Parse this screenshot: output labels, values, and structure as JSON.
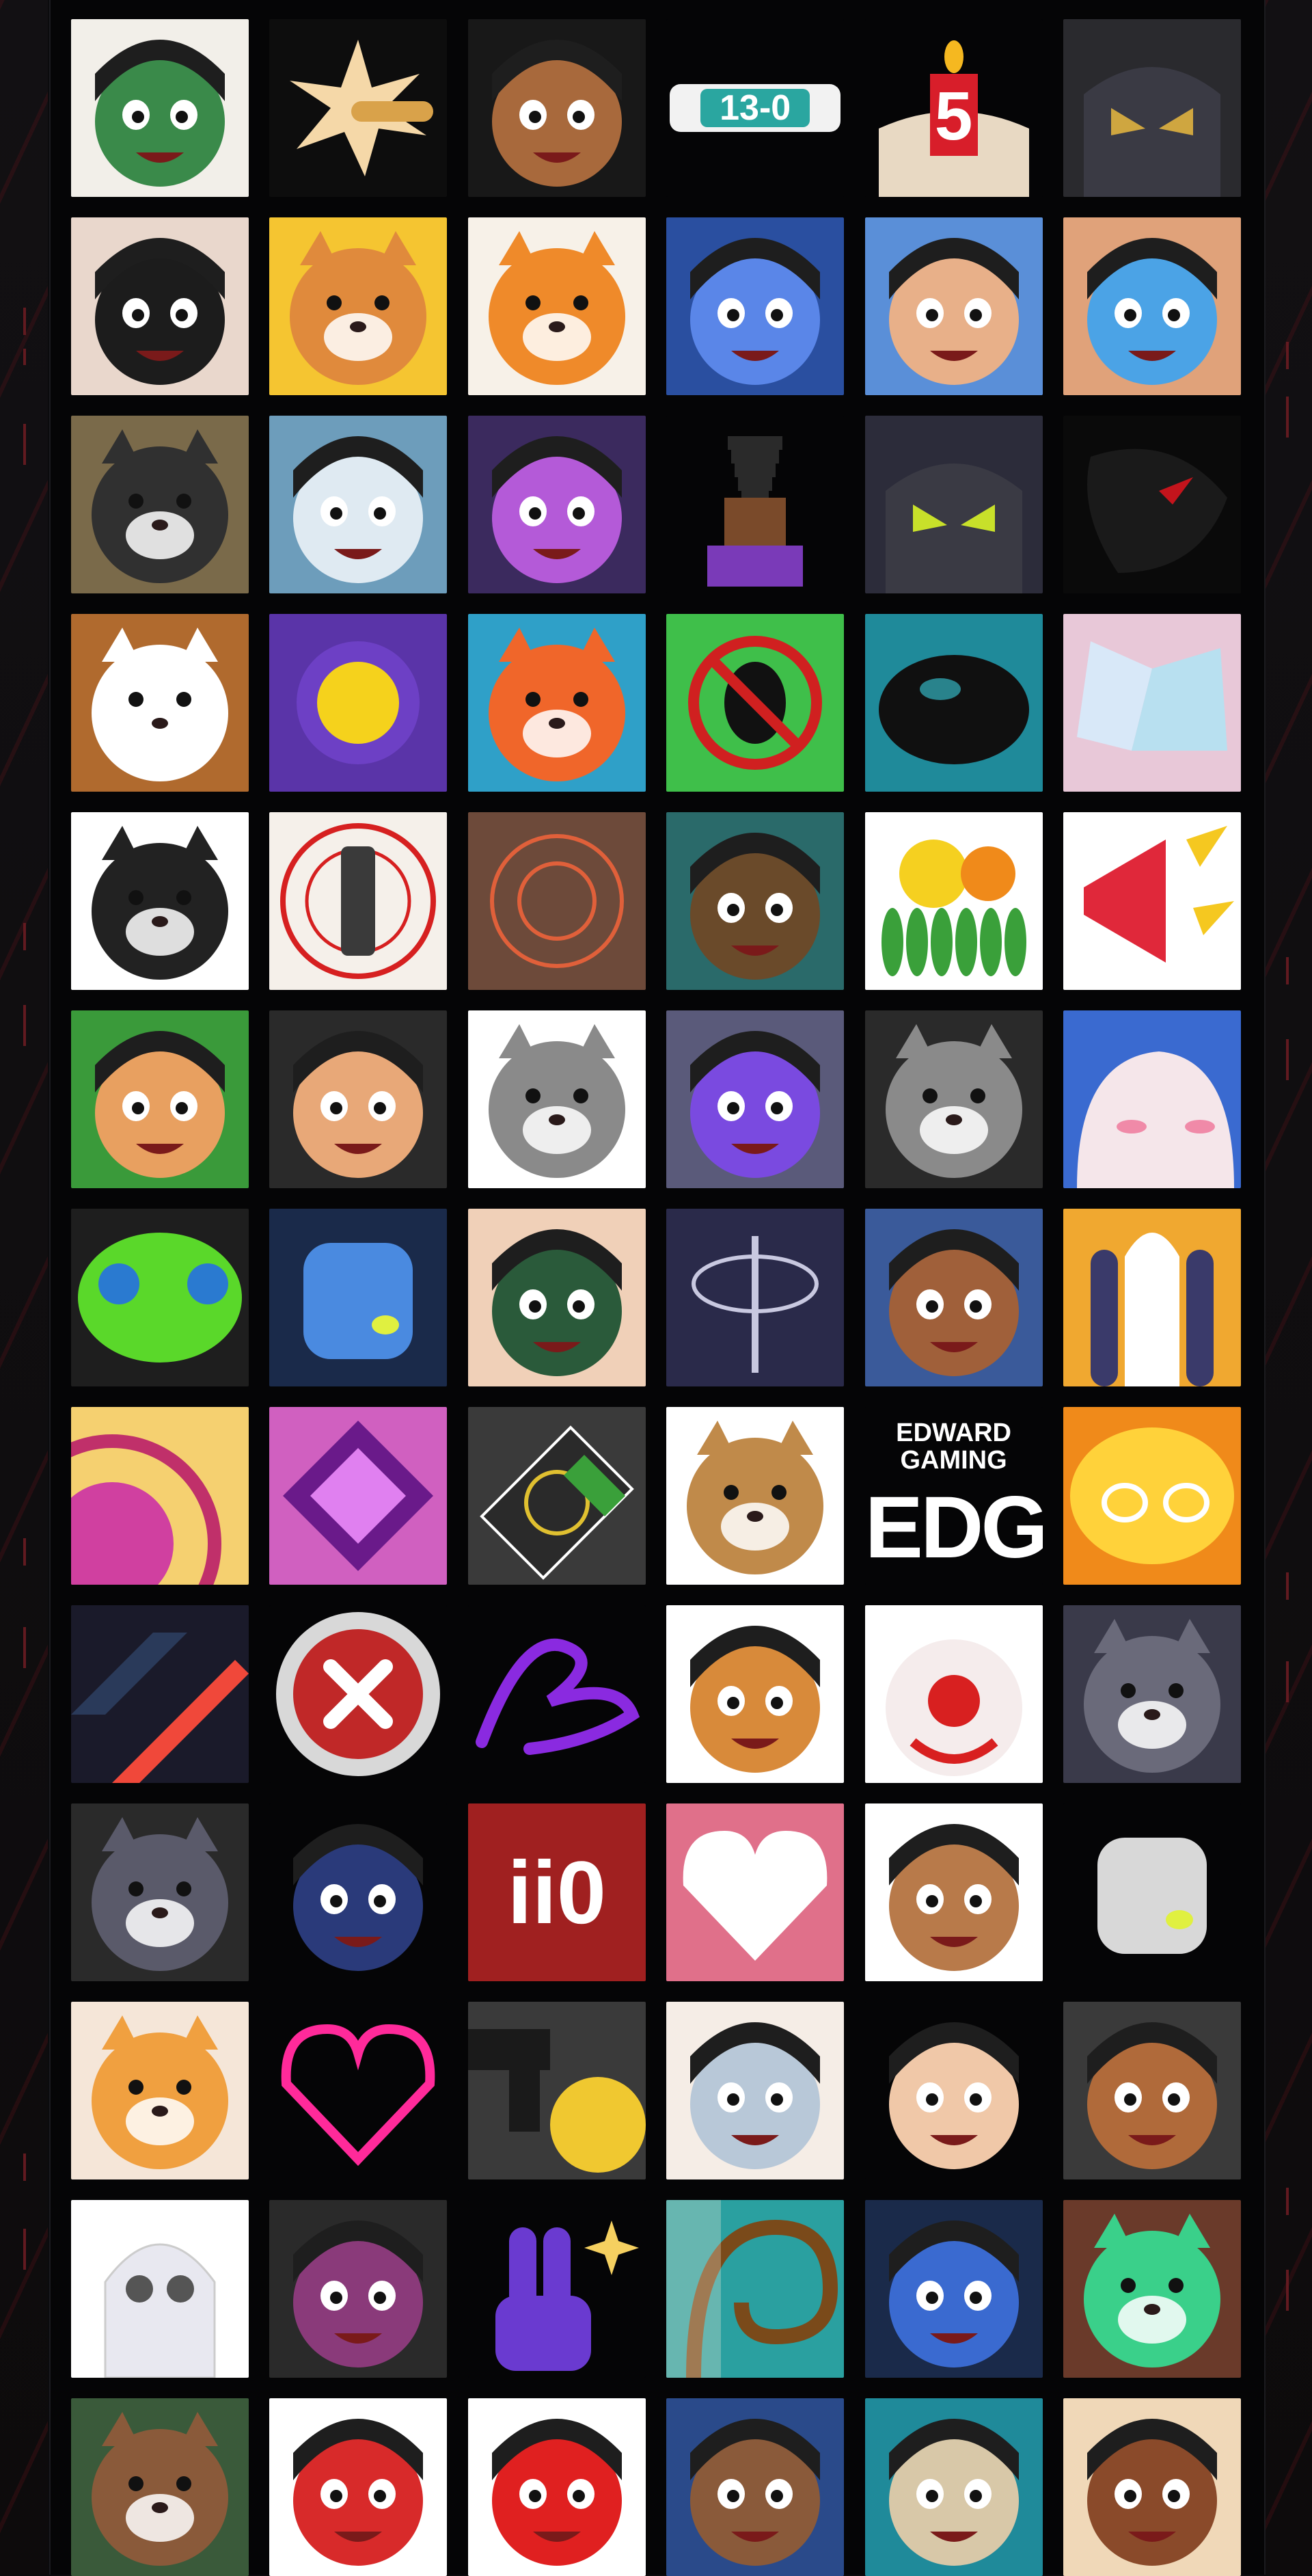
{
  "emotes": [
    {
      "name": "skye-laugh-emote",
      "bg": "#f2efe9",
      "fg": "#3a8a4a",
      "shape": "face",
      "text": ""
    },
    {
      "name": "bullet-impact-emote",
      "bg": "#0d0d0d",
      "fg": "#d9a24a",
      "shape": "burst",
      "text": ""
    },
    {
      "name": "bearded-grin-emote",
      "bg": "#181818",
      "fg": "#a8693c",
      "shape": "face",
      "text": ""
    },
    {
      "name": "score-13-0-emote",
      "bg": "#050506",
      "fg": "#2aa6a0",
      "shape": "badge",
      "text": "13-0"
    },
    {
      "name": "birthday-candle-5-emote",
      "bg": "#050506",
      "fg": "#e8d9c3",
      "shape": "cake",
      "text": "5"
    },
    {
      "name": "masked-agent-emote",
      "bg": "#2a2a2e",
      "fg": "#cfa640",
      "shape": "mask",
      "text": ""
    },
    {
      "name": "smug-face-emote",
      "bg": "#e9d7cc",
      "fg": "#1c1c1c",
      "shape": "face",
      "text": ""
    },
    {
      "name": "corgi-medal-emote",
      "bg": "#f5c531",
      "fg": "#e08a3c",
      "shape": "animal",
      "text": ""
    },
    {
      "name": "lucky-tiger-emote",
      "bg": "#f7f1e8",
      "fg": "#ef8a2a",
      "shape": "animal",
      "text": ""
    },
    {
      "name": "neon-agent-emote",
      "bg": "#2a4fa0",
      "fg": "#5a86e8",
      "shape": "face",
      "text": ""
    },
    {
      "name": "shocked-bandage-emote",
      "bg": "#5a8fd8",
      "fg": "#e8b089",
      "shape": "face",
      "text": ""
    },
    {
      "name": "crying-agent-emote",
      "bg": "#e0a27a",
      "fg": "#4ba3e6",
      "shape": "face",
      "text": ""
    },
    {
      "name": "penguin-peek-emote",
      "bg": "#7a6a4a",
      "fg": "#303030",
      "shape": "animal",
      "text": ""
    },
    {
      "name": "ghost-stare-emote",
      "bg": "#6d9dbb",
      "fg": "#dfeaf2",
      "shape": "face",
      "text": ""
    },
    {
      "name": "glowing-eyes-agent-emote",
      "bg": "#3b2a5e",
      "fg": "#b45ad8",
      "shape": "face",
      "text": ""
    },
    {
      "name": "pixel-agent-emote",
      "bg": "#050506",
      "fg": "#7a4a2a",
      "shape": "pixel",
      "text": ""
    },
    {
      "name": "armored-visor-emote",
      "bg": "#2c2c3a",
      "fg": "#c8e02a",
      "shape": "mask",
      "text": ""
    },
    {
      "name": "dark-shadow-emote",
      "bg": "#0a0a0a",
      "fg": "#c4141c",
      "shape": "shadow",
      "text": ""
    },
    {
      "name": "bear-mouth-emote",
      "bg": "#b06a2e",
      "fg": "#ffffff",
      "shape": "animal",
      "text": ""
    },
    {
      "name": "gold-orb-emote",
      "bg": "#5a34a8",
      "fg": "#f5d21c",
      "shape": "orb",
      "text": ""
    },
    {
      "name": "orange-creature-emote",
      "bg": "#2fa0c8",
      "fg": "#f0662a",
      "shape": "animal",
      "text": ""
    },
    {
      "name": "no-bug-emote",
      "bg": "#3fbf4a",
      "fg": "#d02020",
      "shape": "nobug",
      "text": ""
    },
    {
      "name": "cyan-goggles-emote",
      "bg": "#1f8a9a",
      "fg": "#101010",
      "shape": "goggle",
      "text": ""
    },
    {
      "name": "crystal-shards-emote",
      "bg": "#e8c8d8",
      "fg": "#b8e0f0",
      "shape": "crystal",
      "text": ""
    },
    {
      "name": "white-cat-smile-emote",
      "bg": "#ffffff",
      "fg": "#222222",
      "shape": "animal",
      "text": ""
    },
    {
      "name": "target-lantern-emote",
      "bg": "#f5f0ea",
      "fg": "#d62020",
      "shape": "target",
      "text": ""
    },
    {
      "name": "orange-rings-emote",
      "bg": "#6d4a3a",
      "fg": "#e0603a",
      "shape": "rings",
      "text": ""
    },
    {
      "name": "agent-chibi-emote",
      "bg": "#2a6a6a",
      "fg": "#6a4a2a",
      "shape": "face",
      "text": ""
    },
    {
      "name": "fruit-basket-emote",
      "bg": "#ffffff",
      "fg": "#3aa03a",
      "shape": "fruit",
      "text": ""
    },
    {
      "name": "megaphone-emote",
      "bg": "#ffffff",
      "fg": "#e0283a",
      "shape": "megaphone",
      "text": ""
    },
    {
      "name": "angry-bandana-emote",
      "bg": "#3a9a3a",
      "fg": "#e8a060",
      "shape": "face",
      "text": ""
    },
    {
      "name": "glasses-grin-emote",
      "bg": "#2a2a2a",
      "fg": "#e8a878",
      "shape": "face",
      "text": ""
    },
    {
      "name": "seal-smirk-emote",
      "bg": "#ffffff",
      "fg": "#8a8a8a",
      "shape": "animal",
      "text": ""
    },
    {
      "name": "purple-eyes-agent-emote",
      "bg": "#5a5a7a",
      "fg": "#7a4ae0",
      "shape": "face",
      "text": ""
    },
    {
      "name": "grumpy-cat-emote",
      "bg": "#2a2a2a",
      "fg": "#8a8a8a",
      "shape": "animal",
      "text": ""
    },
    {
      "name": "blush-blob-emote",
      "bg": "#3a6ad0",
      "fg": "#f5e6ea",
      "shape": "blob",
      "text": ""
    },
    {
      "name": "green-slime-emote",
      "bg": "#1e1e1e",
      "fg": "#5ad82a",
      "shape": "slime",
      "text": ""
    },
    {
      "name": "blue-robot-emote",
      "bg": "#1a2a4a",
      "fg": "#4a8ae0",
      "shape": "robot",
      "text": ""
    },
    {
      "name": "pouting-face-emote",
      "bg": "#f0d0b8",
      "fg": "#2a5a3a",
      "shape": "face",
      "text": ""
    },
    {
      "name": "orbit-staff-emote",
      "bg": "#2a2a4a",
      "fg": "#c8c8e0",
      "shape": "orbit",
      "text": ""
    },
    {
      "name": "sunglasses-peek-emote",
      "bg": "#3a5a9a",
      "fg": "#a0603a",
      "shape": "face",
      "text": ""
    },
    {
      "name": "rocket-launch-emote",
      "bg": "#f0a830",
      "fg": "#ffffff",
      "shape": "rocket",
      "text": ""
    },
    {
      "name": "purple-sun-emote",
      "bg": "#f5d070",
      "fg": "#c0306a",
      "shape": "sun",
      "text": ""
    },
    {
      "name": "pink-gem-emote",
      "bg": "#d060c0",
      "fg": "#e080f0",
      "shape": "gem",
      "text": ""
    },
    {
      "name": "green-gpu-emote",
      "bg": "#3a3a3a",
      "fg": "#3aa03a",
      "shape": "gpu",
      "text": ""
    },
    {
      "name": "angry-hamster-emote",
      "bg": "#ffffff",
      "fg": "#c08a4a",
      "shape": "animal",
      "text": ""
    },
    {
      "name": "edg-logo-emote",
      "bg": "#050506",
      "fg": "#ffffff",
      "shape": "edg",
      "text": "EDWARD GAMING",
      "text2": "EDG"
    },
    {
      "name": "orange-glow-emote",
      "bg": "#f08a1a",
      "fg": "#ffd23a",
      "shape": "glow",
      "text": ""
    },
    {
      "name": "red-arrow-emote",
      "bg": "#1a1a2a",
      "fg": "#f0483a",
      "shape": "arrow",
      "text": ""
    },
    {
      "name": "red-x-emote",
      "bg": "#050506",
      "fg": "#c02828",
      "shape": "xbutton",
      "text": ""
    },
    {
      "name": "purple-signature-emote",
      "bg": "#050506",
      "fg": "#8a2ae0",
      "shape": "signature",
      "text": ""
    },
    {
      "name": "goggle-tiger-emote",
      "bg": "#ffffff",
      "fg": "#d88a3a",
      "shape": "face",
      "text": ""
    },
    {
      "name": "clown-nose-emote",
      "bg": "#ffffff",
      "fg": "#d82020",
      "shape": "clown",
      "text": ""
    },
    {
      "name": "crying-seal-emote",
      "bg": "#3a3a4a",
      "fg": "#6a6a7a",
      "shape": "animal",
      "text": ""
    },
    {
      "name": "laughing-cat-emote",
      "bg": "#2a2a2a",
      "fg": "#5a5a6a",
      "shape": "animal",
      "text": ""
    },
    {
      "name": "hooded-agent-emote",
      "bg": "#050506",
      "fg": "#2a3a7a",
      "shape": "face",
      "text": ""
    },
    {
      "name": "ii0-logo-emote",
      "bg": "#a02020",
      "fg": "#ffffff",
      "shape": "logo",
      "text": "ii0"
    },
    {
      "name": "pixel-heart-emote",
      "bg": "#e0708a",
      "fg": "#ffffff",
      "shape": "heart",
      "text": ""
    },
    {
      "name": "nervous-glasses-emote",
      "bg": "#ffffff",
      "fg": "#b87a4a",
      "shape": "face",
      "text": ""
    },
    {
      "name": "signal-robot-emote",
      "bg": "#050506",
      "fg": "#d8d8d8",
      "shape": "robot",
      "text": ""
    },
    {
      "name": "orange-bird-emote",
      "bg": "#f5e6d8",
      "fg": "#f0a040",
      "shape": "animal",
      "text": ""
    },
    {
      "name": "neon-heart-emote",
      "bg": "#050506",
      "fg": "#ff2a9a",
      "shape": "neonheart",
      "text": ""
    },
    {
      "name": "pistol-creature-emote",
      "bg": "#3a3a3a",
      "fg": "#f0c830",
      "shape": "gun",
      "text": ""
    },
    {
      "name": "white-hair-agent-emote",
      "bg": "#f5ede6",
      "fg": "#b8c8d8",
      "shape": "face",
      "text": ""
    },
    {
      "name": "glasses-agent-emote",
      "bg": "#050506",
      "fg": "#f0c8a8",
      "shape": "face",
      "text": ""
    },
    {
      "name": "happy-agent-emote",
      "bg": "#3a3a3a",
      "fg": "#b06a3a",
      "shape": "face",
      "text": ""
    },
    {
      "name": "ghost-eyes-emote",
      "bg": "#ffffff",
      "fg": "#e8e8f0",
      "shape": "ghost",
      "text": ""
    },
    {
      "name": "magenta-grin-emote",
      "bg": "#2a2a2a",
      "fg": "#8a3a7a",
      "shape": "face",
      "text": ""
    },
    {
      "name": "peace-sign-emote",
      "bg": "#050506",
      "fg": "#6a3ad0",
      "shape": "peace",
      "text": ""
    },
    {
      "name": "teal-swirl-emote",
      "bg": "#2aa0a0",
      "fg": "#f5ecd8",
      "shape": "swirl",
      "text": ""
    },
    {
      "name": "masked-ninja-emote",
      "bg": "#1a2a4a",
      "fg": "#3a6ad0",
      "shape": "face",
      "text": ""
    },
    {
      "name": "horned-beast-emote",
      "bg": "#6a3a2a",
      "fg": "#3ad08a",
      "shape": "animal",
      "text": ""
    },
    {
      "name": "bear-sunglasses-emote",
      "bg": "#3a5a3a",
      "fg": "#8a5a3a",
      "shape": "animal",
      "text": ""
    },
    {
      "name": "mustache-man-emote",
      "bg": "#ffffff",
      "fg": "#d82a2a",
      "shape": "face",
      "text": ""
    },
    {
      "name": "red-card-emote",
      "bg": "#ffffff",
      "fg": "#e02020",
      "shape": "face",
      "text": ""
    },
    {
      "name": "swirl-eyes-emote",
      "bg": "#2a4a8a",
      "fg": "#8a5a3a",
      "shape": "face",
      "text": ""
    },
    {
      "name": "visor-cat-emote",
      "bg": "#1f8a9a",
      "fg": "#d8c8a8",
      "shape": "face",
      "text": ""
    },
    {
      "name": "bearded-shout-emote",
      "bg": "#f0d8b8",
      "fg": "#8a4a2a",
      "shape": "face",
      "text": ""
    }
  ]
}
